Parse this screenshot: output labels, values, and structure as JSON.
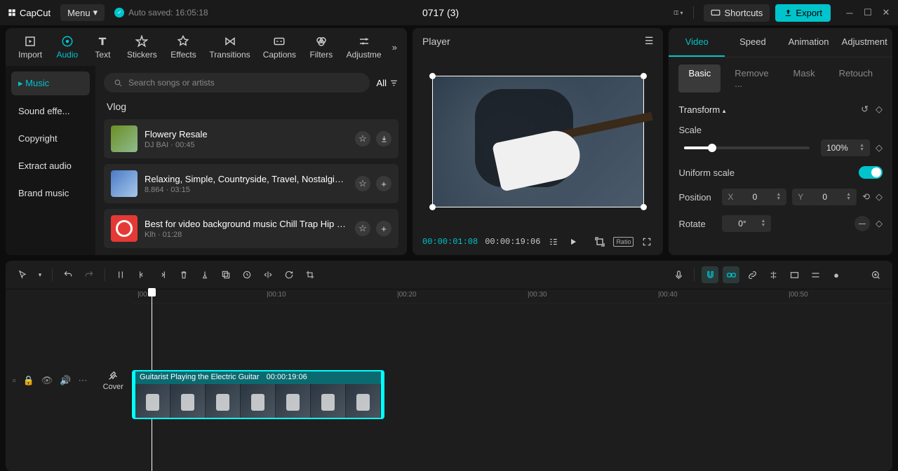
{
  "app": {
    "name": "CapCut",
    "menu": "Menu",
    "autosave": "Auto saved: 16:05:18",
    "title": "0717 (3)",
    "shortcuts": "Shortcuts",
    "export": "Export"
  },
  "mediaTabs": {
    "import": "Import",
    "audio": "Audio",
    "text": "Text",
    "stickers": "Stickers",
    "effects": "Effects",
    "transitions": "Transitions",
    "captions": "Captions",
    "filters": "Filters",
    "adjust": "Adjustme"
  },
  "cats": {
    "music": "Music",
    "sfx": "Sound effe...",
    "copyright": "Copyright",
    "extract": "Extract audio",
    "brand": "Brand music"
  },
  "search": {
    "placeholder": "Search songs or artists",
    "filter": "All"
  },
  "section": "Vlog",
  "tracks": [
    {
      "name": "Flowery Resale",
      "sub": "DJ BAI · 00:45"
    },
    {
      "name": "Relaxing, Simple, Countryside, Travel, Nostalgic(...",
      "sub": "8.864 · 03:15"
    },
    {
      "name": "Best for video background music Chill Trap Hip H...",
      "sub": "Klh · 01:28"
    }
  ],
  "player": {
    "title": "Player",
    "cur": "00:00:01:08",
    "dur": "00:00:19:06",
    "ratio": "Ratio"
  },
  "rtabs": {
    "video": "Video",
    "speed": "Speed",
    "animation": "Animation",
    "adjustment": "Adjustment"
  },
  "subtabs": {
    "basic": "Basic",
    "remove": "Remove ...",
    "mask": "Mask",
    "retouch": "Retouch"
  },
  "props": {
    "transform": "Transform",
    "scale": "Scale",
    "scaleVal": "100%",
    "uniform": "Uniform scale",
    "position": "Position",
    "x": "X",
    "xval": "0",
    "y": "Y",
    "yval": "0",
    "rotate": "Rotate",
    "rotVal": "0°"
  },
  "timeline": {
    "marks": [
      "|00:0",
      "|00:10",
      "|00:20",
      "|00:30",
      "|00:40",
      "|00:50"
    ],
    "clipName": "Guitarist Playing the Electric Guitar",
    "clipDur": "00:00:19:06",
    "cover": "Cover"
  }
}
